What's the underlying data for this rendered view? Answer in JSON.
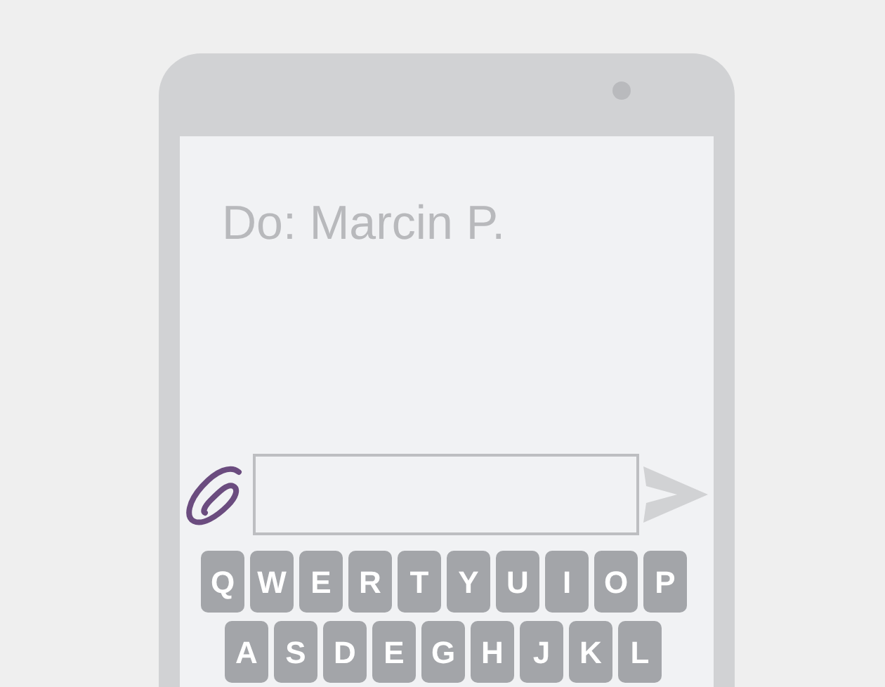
{
  "recipient": "Do: Marcin P.",
  "keyboard": {
    "rows": [
      [
        "Q",
        "W",
        "E",
        "R",
        "T",
        "Y",
        "U",
        "I",
        "O",
        "P"
      ],
      [
        "A",
        "S",
        "D",
        "E",
        "G",
        "H",
        "J",
        "K",
        "L"
      ]
    ]
  }
}
